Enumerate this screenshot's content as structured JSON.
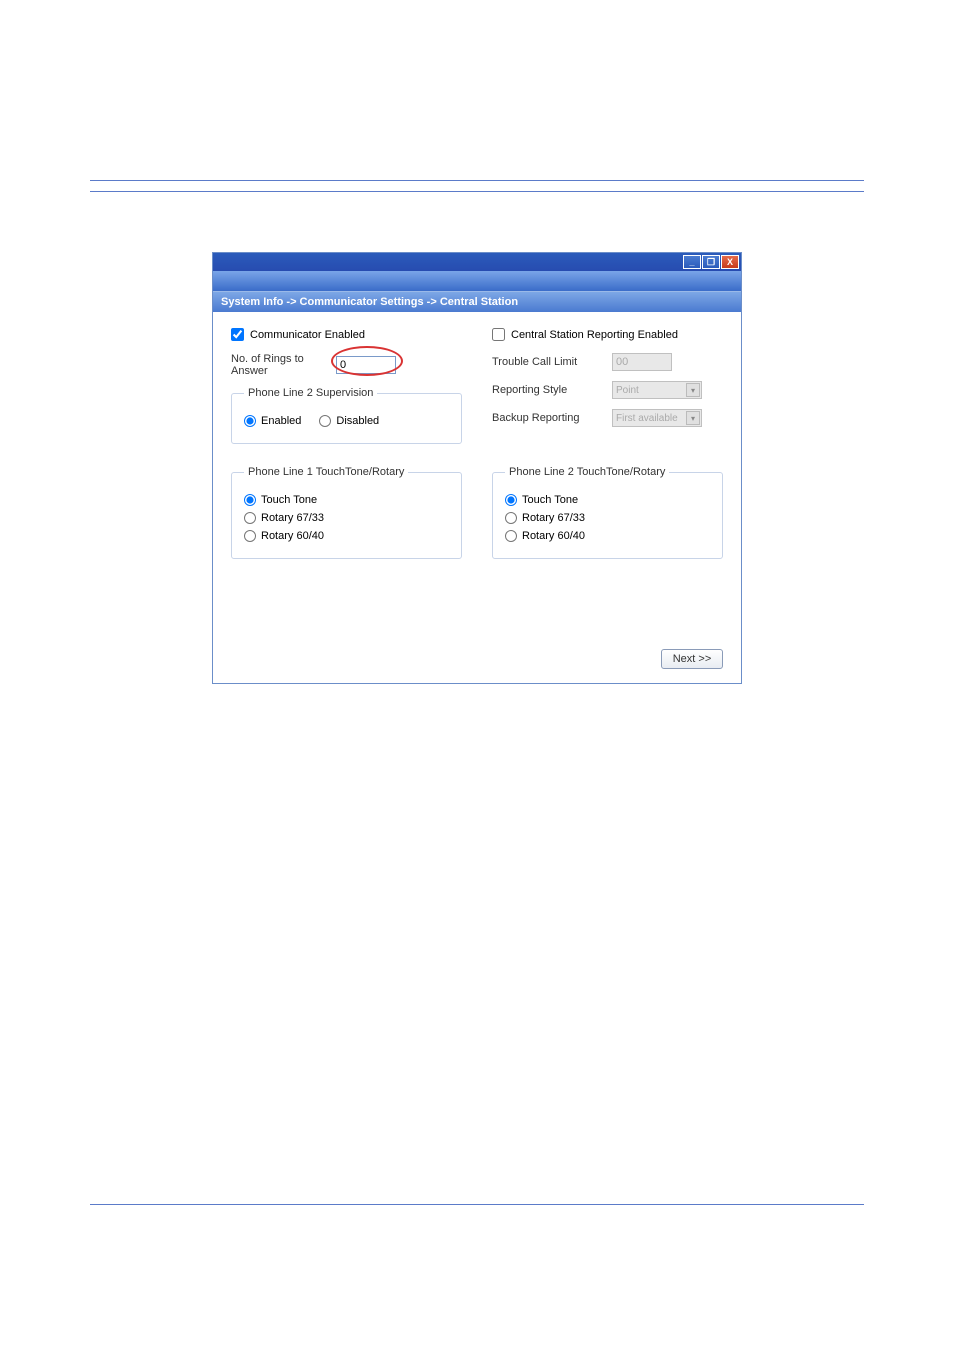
{
  "titlebar": {
    "min": "_",
    "max": "❐",
    "close": "X"
  },
  "breadcrumb": "System Info -> Communicator Settings -> Central Station",
  "left": {
    "communicator_enabled_label": "Communicator Enabled",
    "rings_label": "No. of Rings to Answer",
    "rings_value": "0",
    "phone2_supervision_legend": "Phone Line 2 Supervision",
    "enabled_label": "Enabled",
    "disabled_label": "Disabled",
    "phone1_touch_legend": "Phone Line 1 TouchTone/Rotary",
    "touch_tone": "Touch Tone",
    "rotary_6733": "Rotary 67/33",
    "rotary_6040": "Rotary 60/40"
  },
  "right": {
    "central_station_label": "Central Station Reporting Enabled",
    "trouble_call_label": "Trouble Call Limit",
    "trouble_call_value": "00",
    "reporting_style_label": "Reporting Style",
    "reporting_style_value": "Point",
    "backup_reporting_label": "Backup Reporting",
    "backup_reporting_value": "First available",
    "phone2_touch_legend": "Phone Line 2 TouchTone/Rotary",
    "touch_tone": "Touch Tone",
    "rotary_6733": "Rotary 67/33",
    "rotary_6040": "Rotary 60/40"
  },
  "next_button": "Next >>"
}
